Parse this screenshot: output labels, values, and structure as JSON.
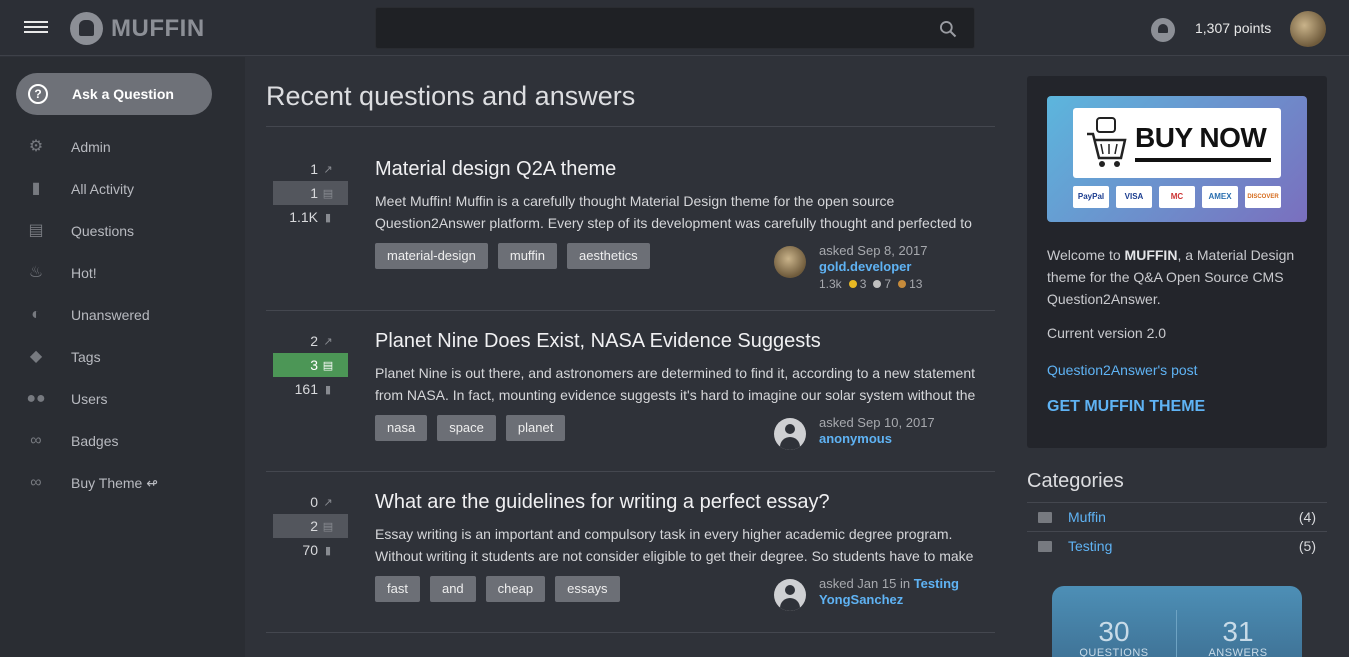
{
  "header": {
    "logo_text": "MUFFIN",
    "points": "1,307 points",
    "search_value": ""
  },
  "sidebar": {
    "ask_label": "Ask a Question",
    "items": [
      {
        "label": "Admin",
        "icon": "gear-icon"
      },
      {
        "label": "All Activity",
        "icon": "bar-chart-icon"
      },
      {
        "label": "Questions",
        "icon": "clipboard-icon"
      },
      {
        "label": "Hot!",
        "icon": "fire-icon"
      },
      {
        "label": "Unanswered",
        "icon": "half-circle-icon"
      },
      {
        "label": "Tags",
        "icon": "tag-icon"
      },
      {
        "label": "Users",
        "icon": "people-icon"
      },
      {
        "label": "Badges",
        "icon": "link-icon"
      },
      {
        "label": "Buy Theme ↫",
        "icon": "link-icon"
      }
    ]
  },
  "main": {
    "title": "Recent questions and answers",
    "questions": [
      {
        "votes": "1",
        "answers": "1",
        "views": "1.1K",
        "accepted": false,
        "title": "Material design Q2A theme",
        "excerpt": "Meet Muffin! Muffin is a carefully thought Material Design theme for the open source Question2Answer platform. Every step of its development was carefully thought and perfected to",
        "tags": [
          "material-design",
          "muffin",
          "aesthetics"
        ],
        "asked": "asked Sep 8, 2017",
        "user": "gold.developer",
        "rep": "1.3k",
        "gold": "3",
        "silver": "7",
        "bronze": "13",
        "avatar": "photo"
      },
      {
        "votes": "2",
        "answers": "3",
        "views": "161",
        "accepted": true,
        "title": "Planet Nine Does Exist, NASA Evidence Suggests",
        "excerpt": "Planet Nine is out there, and astronomers are determined to find it, according to a new statement from NASA. In fact, mounting evidence suggests it's hard to imagine our solar system without the",
        "tags": [
          "nasa",
          "space",
          "planet"
        ],
        "asked": "asked Sep 10, 2017",
        "user": "anonymous",
        "avatar": "anon"
      },
      {
        "votes": "0",
        "answers": "2",
        "views": "70",
        "accepted": false,
        "title": "What are the guidelines for writing a perfect essay?",
        "excerpt": "Essay writing is an important and compulsory task in every higher academic degree program. Without writing it students are not consider eligible to get their degree. So students have to make",
        "tags": [
          "fast",
          "and",
          "cheap",
          "essays"
        ],
        "asked": "asked Jan 15 in",
        "category": "Testing",
        "user": "YongSanchez",
        "avatar": "anon"
      }
    ]
  },
  "right": {
    "buy_now": "BUY NOW",
    "cards": [
      "PayPal",
      "VISA",
      "MC",
      "AMEX",
      "DISCOVER"
    ],
    "welcome_pre": "Welcome to ",
    "welcome_brand": "MUFFIN",
    "welcome_post": ", a Material Design theme for the Q&A Open Source CMS Question2Answer.",
    "version": "Current version 2.0",
    "q2a_link": "Question2Answer's post",
    "get_theme": "GET MUFFIN THEME",
    "categories_title": "Categories",
    "categories": [
      {
        "name": "Muffin",
        "count": "(4)"
      },
      {
        "name": "Testing",
        "count": "(5)"
      }
    ],
    "stats": {
      "questions_num": "30",
      "questions_label": "QUESTIONS",
      "answers_num": "31",
      "answers_label": "ANSWERS"
    }
  },
  "colors": {
    "accent_link": "#5fb3f4",
    "accepted_green": "#4c9656",
    "gold": "#e8b923",
    "silver": "#c0c0c0",
    "bronze": "#c68b3b"
  }
}
